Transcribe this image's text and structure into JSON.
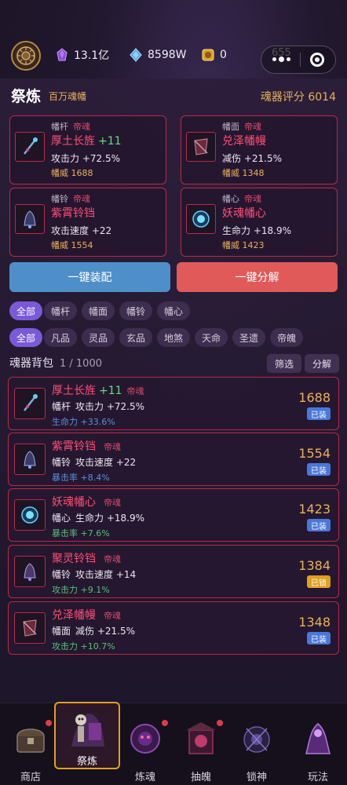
{
  "topbar": {
    "gold": "13.1亿",
    "diamond": "8598W",
    "token": "0",
    "hidden_gem": "655"
  },
  "panel": {
    "title": "祭炼",
    "subtitle": "百万魂幡",
    "score_label": "魂器评分",
    "score_value": "6014"
  },
  "slots": [
    {
      "type": "幡杆",
      "rarity": "帝魂",
      "name": "厚土长旌",
      "plus": "+11",
      "stat": "攻击力 +72.5%",
      "power_label": "幡威",
      "power": "1688"
    },
    {
      "type": "幡面",
      "rarity": "帝魂",
      "name": "兑泽幡幔",
      "plus": "",
      "stat": "减伤 +21.5%",
      "power_label": "幡威",
      "power": "1348"
    },
    {
      "type": "幡铃",
      "rarity": "帝魂",
      "name": "紫霄铃铛",
      "plus": "",
      "stat": "攻击速度 +22",
      "power_label": "幡威",
      "power": "1554"
    },
    {
      "type": "幡心",
      "rarity": "帝魂",
      "name": "妖魂幡心",
      "plus": "",
      "stat": "生命力 +18.9%",
      "power_label": "幡威",
      "power": "1423"
    }
  ],
  "buttons": {
    "equip_all": "一键装配",
    "decompose_all": "一键分解"
  },
  "filters_type": [
    "全部",
    "幡杆",
    "幡面",
    "幡铃",
    "幡心"
  ],
  "filters_grade": [
    "全部",
    "凡品",
    "灵品",
    "玄品",
    "地煞",
    "天命",
    "圣遗",
    "帝魄"
  ],
  "bag": {
    "title": "魂器背包",
    "count": "1 / 1000",
    "filter_btn": "筛选",
    "decompose_btn": "分解"
  },
  "items": [
    {
      "name": "厚土长旌",
      "plus": "+11",
      "rarity": "帝魂",
      "slot": "幡杆",
      "stat": "攻击力 +72.5%",
      "sub": "生命力 +33.6%",
      "sub_color": "blue",
      "power": "1688",
      "badge": "已装",
      "badge_type": "equip"
    },
    {
      "name": "紫霄铃铛",
      "plus": "",
      "rarity": "帝魂",
      "slot": "幡铃",
      "stat": "攻击速度 +22",
      "sub": "暴击率 +8.4%",
      "sub_color": "blue",
      "power": "1554",
      "badge": "已装",
      "badge_type": "equip"
    },
    {
      "name": "妖魂幡心",
      "plus": "",
      "rarity": "帝魂",
      "slot": "幡心",
      "stat": "生命力 +18.9%",
      "sub": "暴击率 +7.6%",
      "sub_color": "green",
      "power": "1423",
      "badge": "已装",
      "badge_type": "equip"
    },
    {
      "name": "聚灵铃铛",
      "plus": "",
      "rarity": "帝魂",
      "slot": "幡铃",
      "stat": "攻击速度 +14",
      "sub": "攻击力 +9.1%",
      "sub_color": "green",
      "power": "1384",
      "badge": "已锁",
      "badge_type": "lock"
    },
    {
      "name": "兑泽幡幔",
      "plus": "",
      "rarity": "帝魂",
      "slot": "幡面",
      "stat": "减伤 +21.5%",
      "sub": "攻击力 +10.7%",
      "sub_color": "green",
      "power": "1348",
      "badge": "已装",
      "badge_type": "equip"
    }
  ],
  "nav": [
    "商店",
    "祭炼",
    "炼魂",
    "抽魄",
    "锁神",
    "玩法"
  ],
  "colors": {
    "accent_red": "#b8294a",
    "name_red": "#ff4f74",
    "gold": "#e7b25a",
    "chip_active": "#7a5ad8",
    "btn_blue": "#4f8fc9",
    "btn_red": "#e05a5a"
  }
}
